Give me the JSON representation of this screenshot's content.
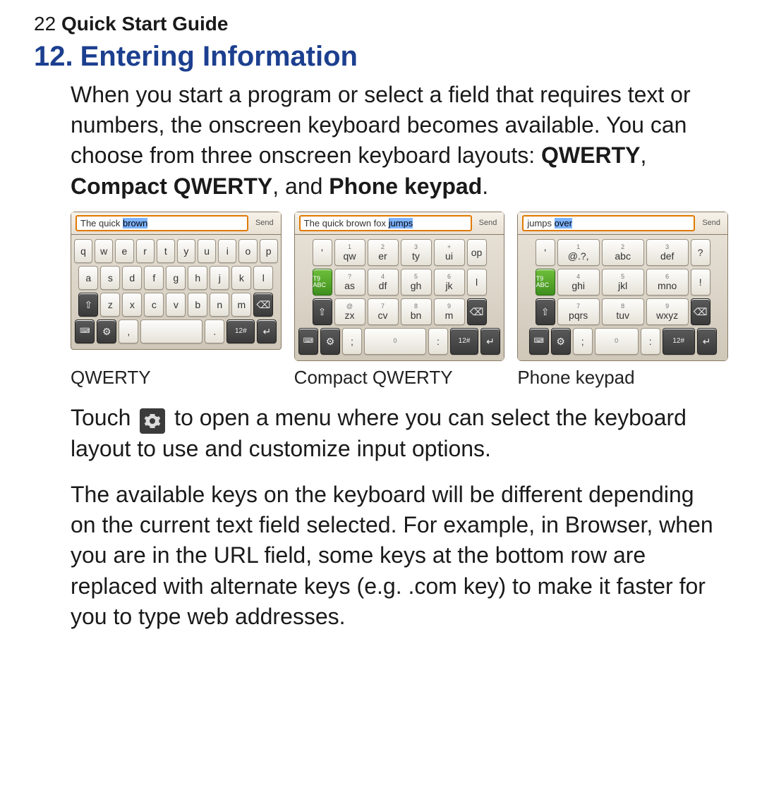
{
  "header": {
    "page_number": "22",
    "running_title": "Quick Start Guide"
  },
  "section": {
    "number": "12.",
    "title": "Entering Information"
  },
  "intro": {
    "before_bold": "When you start a program or select a field that requires text or numbers, the onscreen keyboard becomes available. You can choose from three onscreen keyboard layouts: ",
    "bold_layouts": [
      "QWERTY",
      "Compact QWERTY",
      "Phone keypad"
    ],
    "joiner1": ", ",
    "joiner2": ", and ",
    "after_bold": "."
  },
  "keyboards": {
    "qwerty": {
      "caption": "QWERTY",
      "field_text_pre": "The quick ",
      "field_text_sel": "brown",
      "send": "Send",
      "rows": [
        [
          "q",
          "w",
          "e",
          "r",
          "t",
          "y",
          "u",
          "i",
          "o",
          "p"
        ],
        [
          "a",
          "s",
          "d",
          "f",
          "g",
          "h",
          "j",
          "k",
          "l"
        ],
        [
          "⇧",
          "z",
          "x",
          "c",
          "v",
          "b",
          "n",
          "m",
          "⌫"
        ],
        [
          "⌨",
          "⚙",
          ",",
          "␣",
          ".",
          "12#",
          "↵"
        ]
      ]
    },
    "compact": {
      "caption": "Compact QWERTY",
      "field_text_pre": "The quick brown fox ",
      "field_text_sel": "jumps",
      "send": "Send",
      "rows": [
        {
          "sups": [
            "",
            "1",
            "2",
            "3",
            "+"
          ],
          "labs": [
            "'",
            "qw",
            "er",
            "ty",
            "ui",
            "op"
          ]
        },
        {
          "t9": "T9 ABC",
          "sups": [
            "?",
            "4",
            "5",
            "6",
            "-"
          ],
          "labs": [
            "as",
            "df",
            "gh",
            "jk",
            "l"
          ]
        },
        {
          "shift": "⇧",
          "sups": [
            "@",
            "7",
            "8",
            "9"
          ],
          "labs": [
            "zx",
            "cv",
            "bn",
            "m"
          ],
          "back": "⌫"
        },
        {
          "bottom": [
            "⌨",
            "⚙",
            ";",
            "␣",
            ":",
            "12#",
            "↵"
          ],
          "sup0": "0"
        }
      ]
    },
    "phone": {
      "caption": "Phone keypad",
      "field_text_pre": "jumps ",
      "field_text_sel": "over",
      "send": "Send",
      "rows": [
        {
          "sups": [
            "1",
            "2",
            "3",
            "+"
          ],
          "labs": [
            "'",
            "@.?,",
            "abc",
            "def",
            "?"
          ]
        },
        {
          "t9": "T9 ABC",
          "sups": [
            "4",
            "5",
            "6"
          ],
          "labs": [
            "ghi",
            "jkl",
            "mno",
            "!"
          ]
        },
        {
          "shift": "⇧",
          "sups": [
            "7",
            "8",
            "9"
          ],
          "labs": [
            "pqrs",
            "tuv",
            "wxyz"
          ],
          "back": "⌫"
        },
        {
          "bottom": [
            "⌨",
            "⚙",
            ";",
            "␣",
            ":",
            "12#",
            "↵"
          ],
          "sup0": "0"
        }
      ]
    }
  },
  "touch_para": {
    "before_icon": "Touch ",
    "after_icon": " to open a menu where you can select the keyboard layout to use and customize input options."
  },
  "para2": "The available keys on the keyboard will be different depending on the current text field selected. For example, in Browser, when you are in the URL field, some keys at the bottom row are replaced with alternate keys (e.g. .com key) to make it faster for you to type web addresses."
}
